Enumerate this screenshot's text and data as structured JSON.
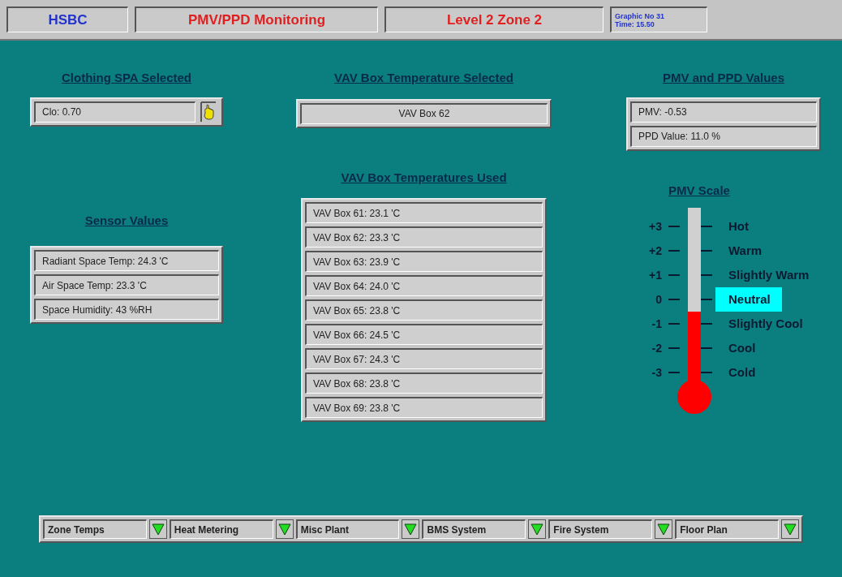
{
  "header": {
    "brand": "HSBC",
    "title": "PMV/PPD Monitoring",
    "zone": "Level 2 Zone 2",
    "info": [
      "Graphic No 31",
      "Time: 15.50"
    ]
  },
  "clothing": {
    "title": "Clothing SPA Selected",
    "value": "Clo: 0.70"
  },
  "sensors": {
    "title": "Sensor Values",
    "rows": [
      "Radiant Space Temp: 24.3 'C",
      "Air Space Temp: 23.3 'C",
      "Space Humidity: 43 %RH"
    ]
  },
  "vav_selected": {
    "title": "VAV Box Temperature Selected",
    "value": "VAV Box 62"
  },
  "vav_used": {
    "title": "VAV Box Temperatures Used",
    "rows": [
      "VAV Box 61: 23.1 'C",
      "VAV Box 62: 23.3 'C",
      "VAV Box 63: 23.9 'C",
      "VAV Box 64: 24.0 'C",
      "VAV Box 65: 23.8 'C",
      "VAV Box 66: 24.5 'C",
      "VAV Box 67: 24.3 'C",
      "VAV Box 68: 23.8 'C",
      "VAV Box 69: 23.8 'C"
    ]
  },
  "pmv_ppd": {
    "title": "PMV and PPD Values",
    "rows": [
      "PMV: -0.53",
      "PPD Value: 11.0 %"
    ]
  },
  "pmv_scale": {
    "title": "PMV Scale",
    "level": 0.42,
    "steps": [
      {
        "value": "+3",
        "label": "Hot",
        "selected": false
      },
      {
        "value": "+2",
        "label": "Warm",
        "selected": false
      },
      {
        "value": "+1",
        "label": "Slightly Warm",
        "selected": false
      },
      {
        "value": "0",
        "label": "Neutral",
        "selected": true
      },
      {
        "value": "-1",
        "label": "Slightly Cool",
        "selected": false
      },
      {
        "value": "-2",
        "label": "Cool",
        "selected": false
      },
      {
        "value": "-3",
        "label": "Cold",
        "selected": false
      }
    ]
  },
  "nav": [
    "Zone Temps",
    "Heat Metering",
    "Misc Plant",
    "BMS System",
    "Fire System",
    "Floor Plan"
  ]
}
